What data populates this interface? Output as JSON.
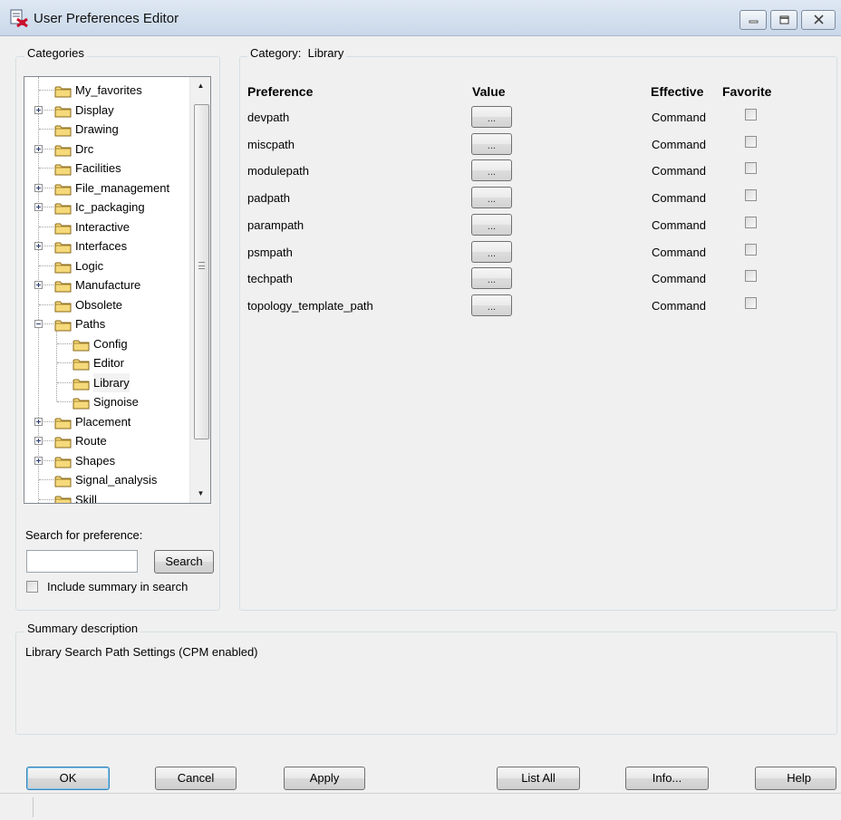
{
  "window": {
    "title": "User Preferences Editor",
    "controls": [
      "minimize-icon",
      "maximize-icon",
      "close-icon"
    ]
  },
  "categories": {
    "label": "Categories",
    "items": [
      {
        "label": "My_favorites",
        "expander": "none",
        "level": 0
      },
      {
        "label": "Display",
        "expander": "plus",
        "level": 0
      },
      {
        "label": "Drawing",
        "expander": "none",
        "level": 0
      },
      {
        "label": "Drc",
        "expander": "plus",
        "level": 0
      },
      {
        "label": "Facilities",
        "expander": "none",
        "level": 0
      },
      {
        "label": "File_management",
        "expander": "plus",
        "level": 0
      },
      {
        "label": "Ic_packaging",
        "expander": "plus",
        "level": 0
      },
      {
        "label": "Interactive",
        "expander": "none",
        "level": 0
      },
      {
        "label": "Interfaces",
        "expander": "plus",
        "level": 0
      },
      {
        "label": "Logic",
        "expander": "none",
        "level": 0
      },
      {
        "label": "Manufacture",
        "expander": "plus",
        "level": 0
      },
      {
        "label": "Obsolete",
        "expander": "none",
        "level": 0
      },
      {
        "label": "Paths",
        "expander": "minus",
        "level": 0
      },
      {
        "label": "Config",
        "expander": "none",
        "level": 1
      },
      {
        "label": "Editor",
        "expander": "none",
        "level": 1
      },
      {
        "label": "Library",
        "expander": "none",
        "level": 1,
        "selected": true
      },
      {
        "label": "Signoise",
        "expander": "none",
        "level": 1
      },
      {
        "label": "Placement",
        "expander": "plus",
        "level": 0
      },
      {
        "label": "Route",
        "expander": "plus",
        "level": 0
      },
      {
        "label": "Shapes",
        "expander": "plus",
        "level": 0
      },
      {
        "label": "Signal_analysis",
        "expander": "none",
        "level": 0
      },
      {
        "label": "Skill",
        "expander": "none",
        "level": 0
      }
    ]
  },
  "search": {
    "label": "Search for preference:",
    "value": "",
    "button": "Search",
    "include_summary_label": "Include summary in search",
    "include_summary_checked": false
  },
  "category_panel": {
    "label": "Category:  Library",
    "headers": {
      "preference": "Preference",
      "value": "Value",
      "effective": "Effective",
      "favorite": "Favorite"
    },
    "rows": [
      {
        "name": "devpath",
        "value_button": "...",
        "effective": "Command",
        "favorite": false
      },
      {
        "name": "miscpath",
        "value_button": "...",
        "effective": "Command",
        "favorite": false
      },
      {
        "name": "modulepath",
        "value_button": "...",
        "effective": "Command",
        "favorite": false
      },
      {
        "name": "padpath",
        "value_button": "...",
        "effective": "Command",
        "favorite": false
      },
      {
        "name": "parampath",
        "value_button": "...",
        "effective": "Command",
        "favorite": false
      },
      {
        "name": "psmpath",
        "value_button": "...",
        "effective": "Command",
        "favorite": false
      },
      {
        "name": "techpath",
        "value_button": "...",
        "effective": "Command",
        "favorite": false
      },
      {
        "name": "topology_template_path",
        "value_button": "...",
        "effective": "Command",
        "favorite": false
      }
    ]
  },
  "summary": {
    "label": "Summary description",
    "text": "Library Search Path Settings (CPM enabled)"
  },
  "buttons": {
    "ok": "OK",
    "cancel": "Cancel",
    "apply": "Apply",
    "list_all": "List All",
    "info": "Info...",
    "help": "Help"
  },
  "colors": {
    "folder_fill": "#f5d97a",
    "folder_stroke": "#8a6a1c",
    "title_bar": "#d4e0ee",
    "default_button_border": "#3c7fb1"
  }
}
